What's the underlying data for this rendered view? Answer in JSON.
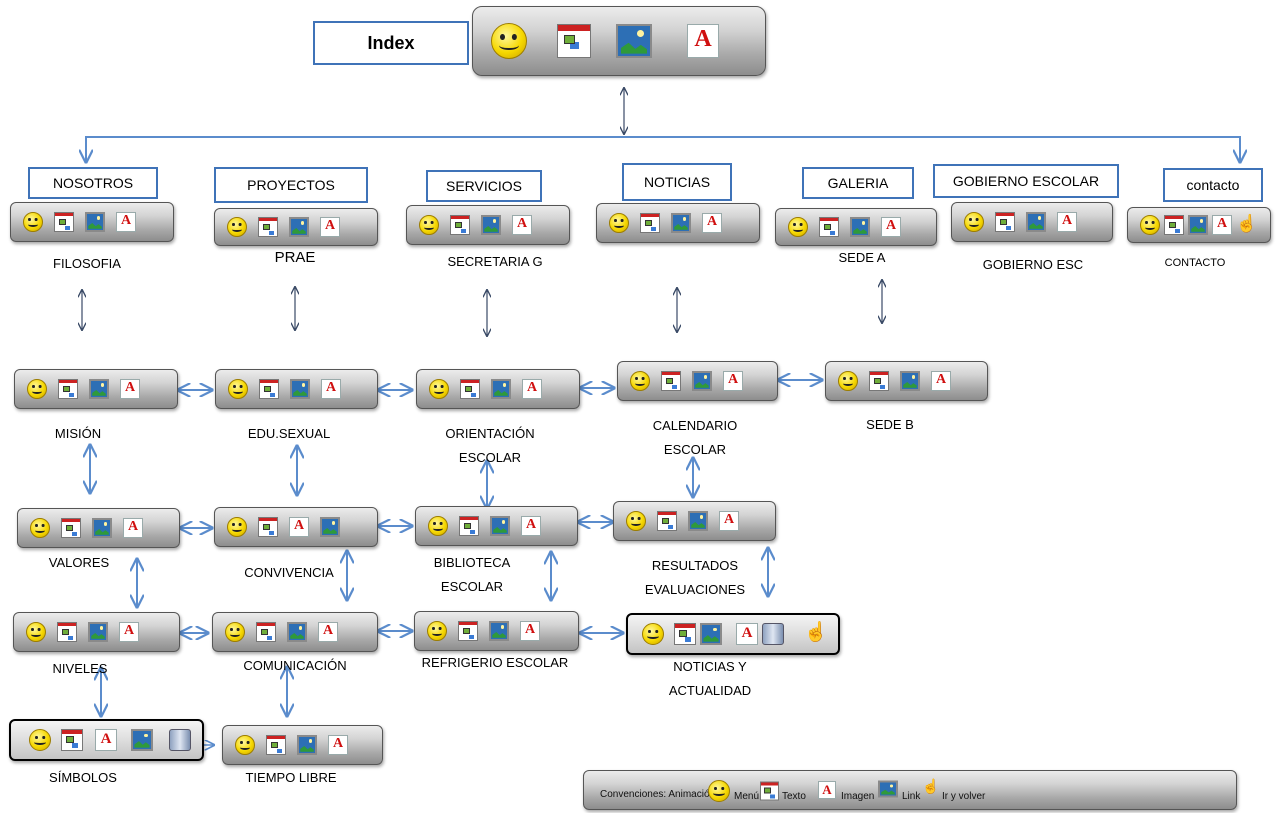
{
  "index": {
    "label": "Index"
  },
  "sections": {
    "nosotros": "NOSOTROS",
    "proyectos": "PROYECTOS",
    "servicios": "SERVICIOS",
    "noticias": "NOTICIAS",
    "galeria": "GALERIA",
    "gobierno": "GOBIERNO ESCOLAR",
    "contacto": "contacto"
  },
  "pages": {
    "filosofia": "FILOSOFIA",
    "prae": "PRAE",
    "secretaria": "SECRETARIA G",
    "sede_a": "SEDE A",
    "gobierno_esc": "GOBIERNO ESC",
    "contacto": "CONTACTO",
    "mision": "MISIÓN",
    "edu_sexual": "EDU.SEXUAL",
    "orientacion_1": "ORIENTACIÓN",
    "orientacion_2": "ESCOLAR",
    "calendario_1": "CALENDARIO",
    "calendario_2": "ESCOLAR",
    "sede_b": "SEDE B",
    "valores": "VALORES",
    "convivencia": "CONVIVENCIA",
    "biblioteca_1": "BIBLIOTECA",
    "biblioteca_2": "ESCOLAR",
    "resultados_1": "RESULTADOS",
    "resultados_2": "EVALUACIONES",
    "niveles": "NIVELES",
    "comunicacion": "COMUNICACIÓN",
    "refrigerio": "REFRIGERIO ESCOLAR",
    "noticias_1": "NOTICIAS Y",
    "noticias_2": "ACTUALIDAD",
    "simbolos": "SÍMBOLOS",
    "tiempo_libre": "TIEMPO LIBRE"
  },
  "legend": {
    "prefix": "Convenciones: Animación",
    "menu": "Menú",
    "texto": "Texto",
    "imagen": "Imagen",
    "link": "Link",
    "ir": "Ir y volver"
  },
  "colors": {
    "accent": "#3f73b8",
    "connector": "#5b8ccc",
    "arrow": "#3a4a66"
  },
  "icons": [
    "smiley-animation-icon",
    "sitemap-menu-icon",
    "picture-link-icon",
    "document-text-icon",
    "hand-pointer-icon",
    "speaker-icon"
  ]
}
